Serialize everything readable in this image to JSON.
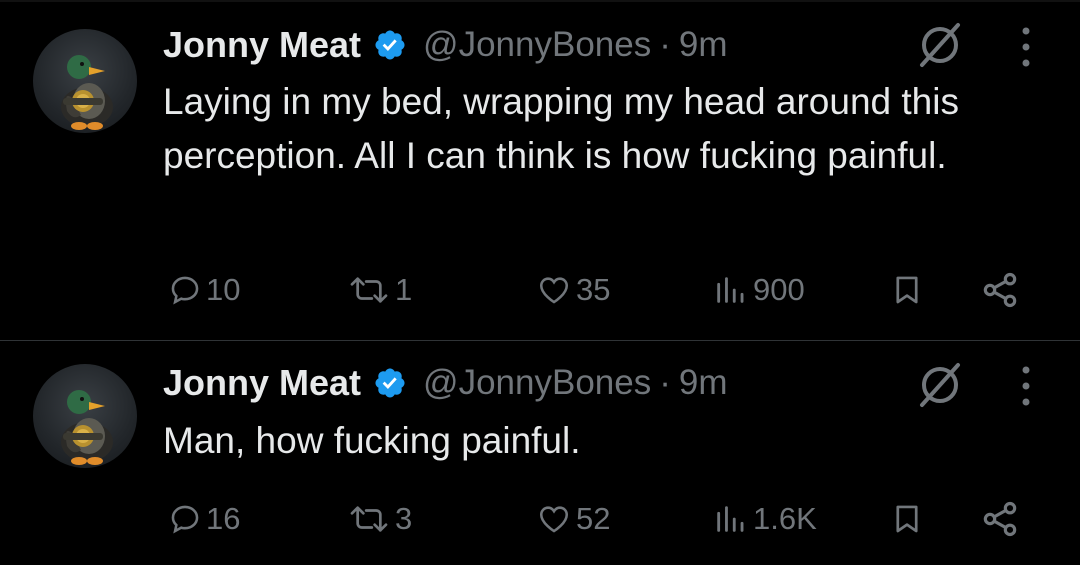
{
  "tweets": [
    {
      "display_name": "Jonny Meat",
      "handle": "@JonnyBones",
      "separator": "·",
      "time": "9m",
      "text": "Laying in my bed, wrapping my head around this perception. All I can think is how fucking painful.",
      "stats": {
        "replies": "10",
        "retweets": "1",
        "likes": "35",
        "views": "900"
      }
    },
    {
      "display_name": "Jonny Meat",
      "handle": "@JonnyBones",
      "separator": "·",
      "time": "9m",
      "text": "Man, how fucking painful.",
      "stats": {
        "replies": "16",
        "retweets": "3",
        "likes": "52",
        "views": "1.6K"
      }
    }
  ],
  "icons": {
    "verified": "verified-badge-icon",
    "grok": "grok-icon",
    "more": "more-dots-icon",
    "reply": "reply-icon",
    "retweet": "retweet-icon",
    "like": "heart-icon",
    "views": "views-bar-chart-icon",
    "bookmark": "bookmark-icon",
    "share": "share-icon"
  },
  "colors": {
    "background": "#000000",
    "text": "#e7e9ea",
    "muted": "#71767b",
    "verified": "#1d9bf0",
    "divider": "#2f3336"
  }
}
